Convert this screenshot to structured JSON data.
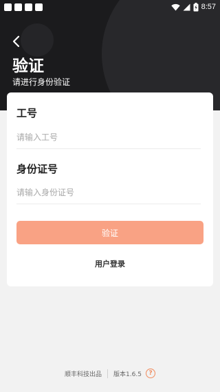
{
  "status_bar": {
    "time": "8:57",
    "notification_icons": [
      "app-notification-icon",
      "app-notification-icon",
      "app-notification-icon",
      "app-notification-icon"
    ],
    "system_icons": [
      "wifi-icon",
      "signal-icon",
      "battery-icon"
    ]
  },
  "header": {
    "back_icon": "chevron-left-icon",
    "title": "验证",
    "subtitle": "请进行身份验证"
  },
  "form": {
    "employee_id": {
      "label": "工号",
      "placeholder": "请输入工号",
      "value": ""
    },
    "id_number": {
      "label": "身份证号",
      "placeholder": "请输入身份证号",
      "value": ""
    },
    "verify_button": "验证",
    "user_login_link": "用户登录"
  },
  "footer": {
    "company": "顺丰科技出品",
    "version": "版本1.6.5",
    "help_icon": "help-icon",
    "help_symbol": "?"
  },
  "colors": {
    "header_bg": "#1b1b1d",
    "page_bg": "#f2f2f2",
    "button_bg": "#f9a284",
    "accent": "#f08b5d"
  }
}
